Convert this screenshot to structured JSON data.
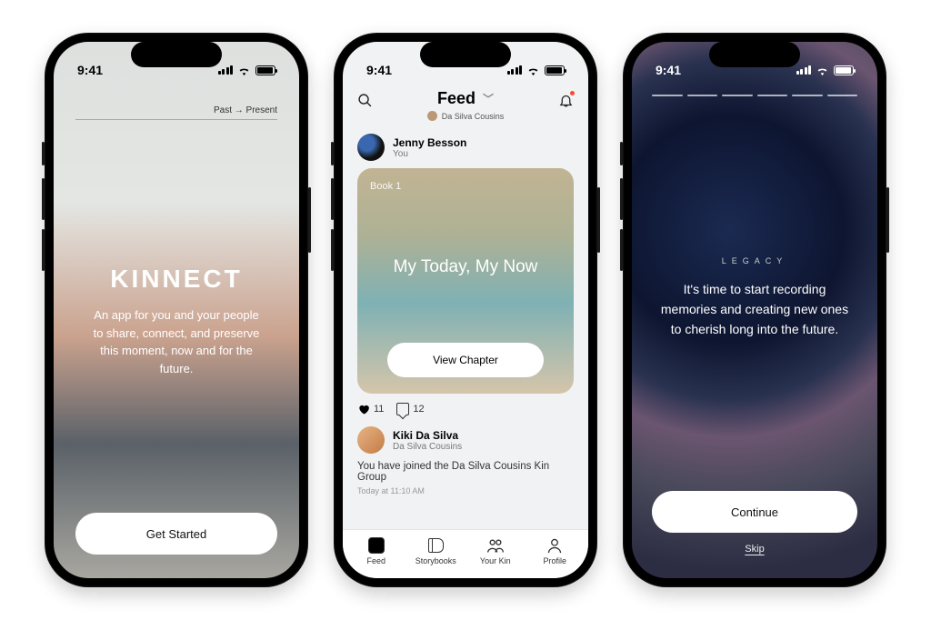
{
  "status": {
    "time": "9:41"
  },
  "phone1": {
    "timeline_label": "Past  →  Present",
    "brand": "KINNECT",
    "tagline": "An app for you and your people to share, connect, and preserve this moment, now and for the future.",
    "cta": "Get Started"
  },
  "phone2": {
    "header": {
      "title": "Feed",
      "group_name": "Da Silva Cousins"
    },
    "post1": {
      "user_name": "Jenny Besson",
      "user_sub": "You",
      "card_label": "Book 1",
      "card_title": "My Today, My Now",
      "card_cta": "View Chapter",
      "likes": "11",
      "comments": "12"
    },
    "post2": {
      "user_name": "Kiki Da Silva",
      "user_sub": "Da Silva Cousins",
      "body": "You have joined the Da Silva Cousins Kin Group",
      "timestamp": "Today at 11:10 AM"
    },
    "tabs": {
      "feed": "Feed",
      "storybooks": "Storybooks",
      "kin": "Your Kin",
      "profile": "Profile"
    }
  },
  "phone3": {
    "eyebrow": "LEGACY",
    "body": "It's time to start recording memories and creating new ones to cherish long into the future.",
    "continue": "Continue",
    "skip": "Skip"
  }
}
